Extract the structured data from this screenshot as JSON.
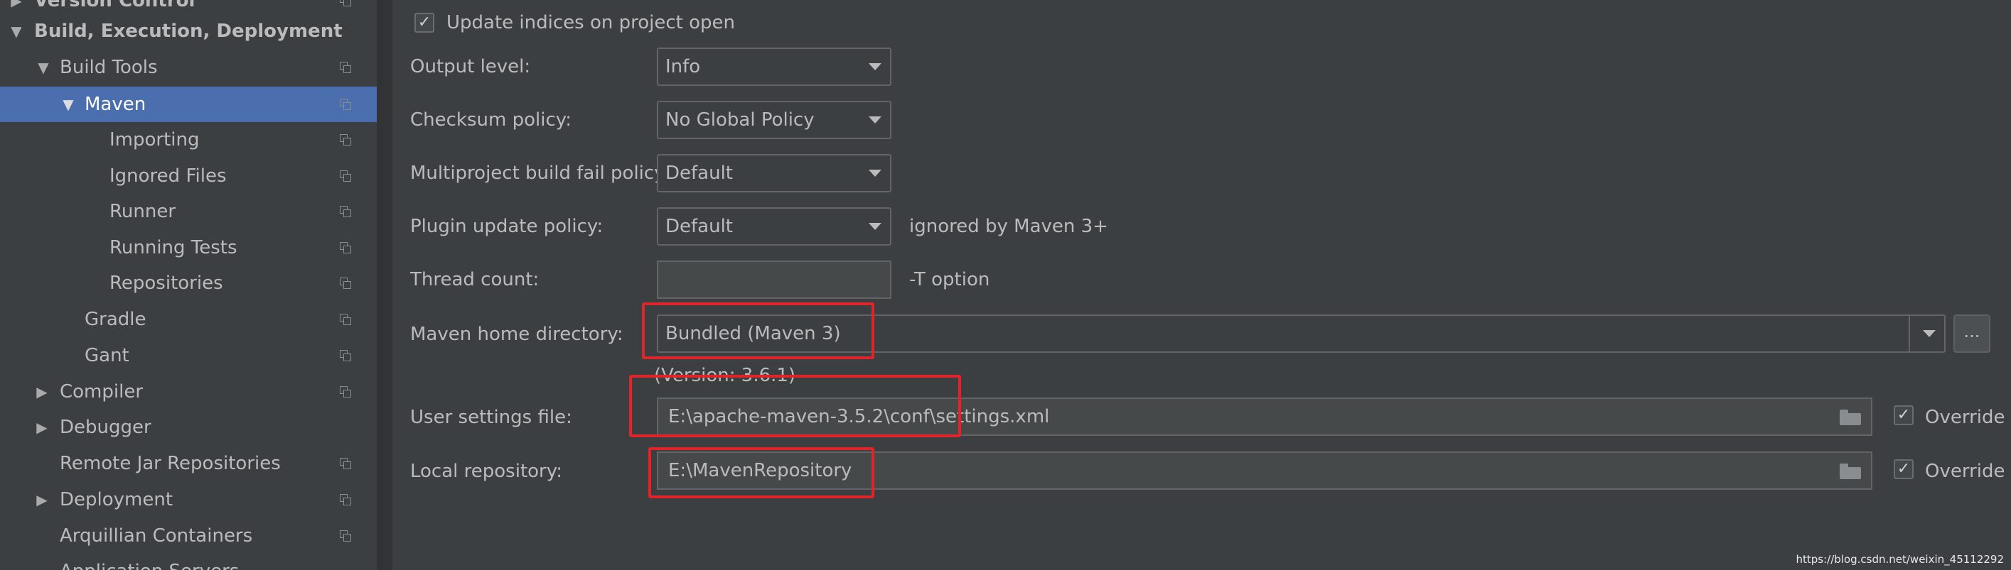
{
  "sidebar": {
    "items": [
      {
        "label": "Version Control",
        "arrow": "▶"
      },
      {
        "label": "Build, Execution, Deployment",
        "arrow": "▼"
      },
      {
        "label": "Build Tools",
        "arrow": "▼"
      },
      {
        "label": "Maven",
        "arrow": "▼"
      },
      {
        "label": "Importing"
      },
      {
        "label": "Ignored Files"
      },
      {
        "label": "Runner"
      },
      {
        "label": "Running Tests"
      },
      {
        "label": "Repositories"
      },
      {
        "label": "Gradle"
      },
      {
        "label": "Gant"
      },
      {
        "label": "Compiler",
        "arrow": "▶"
      },
      {
        "label": "Debugger",
        "arrow": "▶"
      },
      {
        "label": "Remote Jar Repositories"
      },
      {
        "label": "Deployment",
        "arrow": "▶"
      },
      {
        "label": "Arquillian Containers"
      },
      {
        "label": "Application Servers"
      }
    ],
    "icons": {
      "copy": "copy-settings-icon",
      "expanded": "triangle-down-icon",
      "collapsed": "triangle-right-icon"
    }
  },
  "form": {
    "update_indices": {
      "label": "Update indices on project open",
      "checked": true,
      "mark": "✓"
    },
    "output_level": {
      "label": "Output level:",
      "value": "Info"
    },
    "checksum_policy": {
      "label": "Checksum policy:",
      "value": "No Global Policy"
    },
    "multiproject_fail_policy": {
      "label": "Multiproject build fail policy:",
      "value": "Default"
    },
    "plugin_update_policy": {
      "label": "Plugin update policy:",
      "value": "Default",
      "hint": "ignored by Maven 3+"
    },
    "thread_count": {
      "label": "Thread count:",
      "value": "",
      "hint": "-T option"
    },
    "maven_home": {
      "label": "Maven home directory:",
      "value": "Bundled (Maven 3)",
      "version": "(Version: 3.6.1)",
      "browse": "..."
    },
    "user_settings": {
      "label": "User settings file:",
      "value": "E:\\apache-maven-3.5.2\\conf\\settings.xml",
      "override_label": "Override",
      "override_checked": true,
      "mark": "✓"
    },
    "local_repository": {
      "label": "Local repository:",
      "value": "E:\\MavenRepository",
      "override_label": "Override",
      "override_checked": true,
      "mark": "✓"
    }
  },
  "watermark": "https://blog.csdn.net/weixin_45112292",
  "colors": {
    "background": "#3c3f41",
    "selection": "#4b6eaf",
    "text": "#bbbbbb",
    "highlight_box": "#e0242a"
  }
}
